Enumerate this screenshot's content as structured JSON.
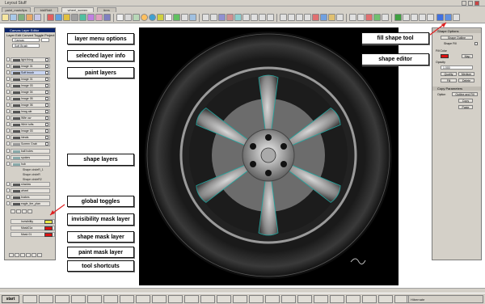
{
  "window": {
    "title": "Leyout Stuff"
  },
  "doc_tabs": [
    "paint_mark/tips",
    "bld/Rid/t",
    "wheel_screen",
    "tires"
  ],
  "left_panel": {
    "title": "Canvas Layer Editor",
    "menus": "Layer  Edit  Convert  Toggle  Project",
    "canvas_field": "Canvas",
    "layer_field": "Soft Brush",
    "paint_layers": [
      "light thing",
      "Image 01",
      "Soft brush",
      "Image 01",
      "Image 03",
      "Image 04",
      "Image 05",
      "Image 06",
      "Imag ale",
      "Wite ow",
      "Whirl tufts",
      "Image 03",
      "Ideals",
      "Screen Grab"
    ],
    "shape_layers": [
      "ball holes",
      "spokes",
      "hub",
      "Shape circleR_1",
      "Shape circleR",
      "Shape circleR2"
    ],
    "bottom_layers": [
      "shadow",
      "wheel",
      "brakes",
      "eagle_tire_plan"
    ],
    "mask_layers": [
      "Invisibility",
      "Mask01a",
      "Mask 01"
    ]
  },
  "callouts": {
    "layer_menu_options": "layer menu options",
    "selected_layer_info": "selected layer info",
    "paint_layers": "paint layers",
    "shape_layers": "shape layers",
    "global_toggles": "global toggles",
    "invisibility_mask_layer": "invisibility mask layer",
    "shape_mask_layer": "shape mask layer",
    "paint_mask_layer": "paint mask layer",
    "tool_shortcuts": "tool shortcuts",
    "fill_shape_tool": "fill shape tool",
    "shape_editor": "shape editor"
  },
  "right_panel": {
    "shape_options": "Shape Options",
    "shape_outline": "Shape Outline",
    "shape_fill": "Shape Fill",
    "fill_color": "Fill Color",
    "map": "Map",
    "opacity": "Opacity",
    "opacity_value": "1.000",
    "quality": "Quality",
    "medium": "Medium",
    "fill": "Fill",
    "delete": "Delete",
    "copy_parameters": "Copy Parameters",
    "option": "Option",
    "outline_and_fill": "Outline and Fill",
    "copy": "Copy",
    "paste": "Paste"
  },
  "taskbar": {
    "start": "start",
    "tray": "Hibernate"
  },
  "colors": {
    "canvas": "#000000",
    "selection": "#c8d4f0",
    "mask_invisibility": "#e8e845",
    "mask_shape": "#dd1111",
    "mask_paint": "#dd1111"
  }
}
